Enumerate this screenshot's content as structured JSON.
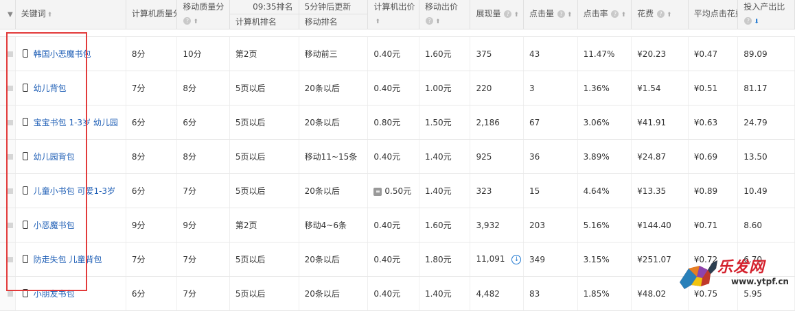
{
  "header": {
    "keyword_label": "关键词",
    "pc_quality_label": "计算机质量分",
    "mobile_quality_label": "移动质量分",
    "rank_time_label": "09:35排名",
    "update_note": "5分钟后更新",
    "pc_rank_label": "计算机排名",
    "mobile_rank_label": "移动排名",
    "pc_bid_label": "计算机出价",
    "mobile_bid_label": "移动出价",
    "impressions_label": "展现量",
    "clicks_label": "点击量",
    "ctr_label": "点击率",
    "cost_label": "花费",
    "avg_cpc_label": "平均点击花费",
    "roi_label": "投入产出比",
    "help_glyph": "?",
    "sort_glyph": "⬆",
    "active_sort_glyph": "⬇",
    "collapse_glyph": "▼"
  },
  "rows": [
    {
      "keyword": "韩国小恶魔书包",
      "pc_quality": "8分",
      "mobile_quality": "10分",
      "pc_rank": "第2页",
      "mobile_rank": "移动前三",
      "pc_bid": "0.40元",
      "mobile_bid": "1.60元",
      "impressions": "375",
      "clicks": "43",
      "ctr": "11.47%",
      "cost": "¥20.23",
      "avg_cpc": "¥0.47",
      "roi": "89.09"
    },
    {
      "keyword": "幼儿背包",
      "pc_quality": "7分",
      "mobile_quality": "8分",
      "pc_rank": "5页以后",
      "mobile_rank": "20条以后",
      "pc_bid": "0.40元",
      "mobile_bid": "1.00元",
      "impressions": "220",
      "clicks": "3",
      "ctr": "1.36%",
      "cost": "¥1.54",
      "avg_cpc": "¥0.51",
      "roi": "81.17"
    },
    {
      "keyword": "宝宝书包 1-3岁 幼儿园",
      "pc_quality": "6分",
      "mobile_quality": "6分",
      "pc_rank": "5页以后",
      "mobile_rank": "20条以后",
      "pc_bid": "0.80元",
      "mobile_bid": "1.50元",
      "impressions": "2,186",
      "clicks": "67",
      "ctr": "3.06%",
      "cost": "¥41.91",
      "avg_cpc": "¥0.63",
      "roi": "24.79"
    },
    {
      "keyword": "幼儿园背包",
      "pc_quality": "8分",
      "mobile_quality": "8分",
      "pc_rank": "5页以后",
      "mobile_rank": "移动11~15条",
      "pc_bid": "0.40元",
      "mobile_bid": "1.40元",
      "impressions": "925",
      "clicks": "36",
      "ctr": "3.89%",
      "cost": "¥24.87",
      "avg_cpc": "¥0.69",
      "roi": "13.50"
    },
    {
      "keyword": "儿童小书包 可爱1-3岁",
      "pc_quality": "6分",
      "mobile_quality": "7分",
      "pc_rank": "5页以后",
      "mobile_rank": "20条以后",
      "pc_bid": "0.50元",
      "mobile_bid": "1.40元",
      "impressions": "323",
      "clicks": "15",
      "ctr": "4.64%",
      "cost": "¥13.35",
      "avg_cpc": "¥0.89",
      "roi": "10.49"
    },
    {
      "keyword": "小恶魔书包",
      "pc_quality": "9分",
      "mobile_quality": "9分",
      "pc_rank": "第2页",
      "mobile_rank": "移动4~6条",
      "pc_bid": "0.40元",
      "mobile_bid": "1.60元",
      "impressions": "3,932",
      "clicks": "203",
      "ctr": "5.16%",
      "cost": "¥144.40",
      "avg_cpc": "¥0.71",
      "roi": "8.60"
    },
    {
      "keyword": "防走失包 儿童背包",
      "pc_quality": "7分",
      "mobile_quality": "7分",
      "pc_rank": "5页以后",
      "mobile_rank": "20条以后",
      "pc_bid": "0.40元",
      "mobile_bid": "1.80元",
      "impressions": "11,091",
      "clicks": "349",
      "ctr": "3.15%",
      "cost": "¥251.07",
      "avg_cpc": "¥0.72",
      "roi": "6.70"
    },
    {
      "keyword": "小朋友书包",
      "pc_quality": "6分",
      "mobile_quality": "7分",
      "pc_rank": "5页以后",
      "mobile_rank": "20条以后",
      "pc_bid": "0.40元",
      "mobile_bid": "1.40元",
      "impressions": "4,482",
      "clicks": "83",
      "ctr": "1.85%",
      "cost": "¥48.02",
      "avg_cpc": "¥0.75",
      "roi": "5.95"
    }
  ],
  "watermark": {
    "brand": "乐发网",
    "url": "www.ytpf.cn"
  },
  "colors": {
    "link": "#1f5fb6",
    "highlight": "#e23a3a",
    "active_sort": "#1f78d1"
  }
}
